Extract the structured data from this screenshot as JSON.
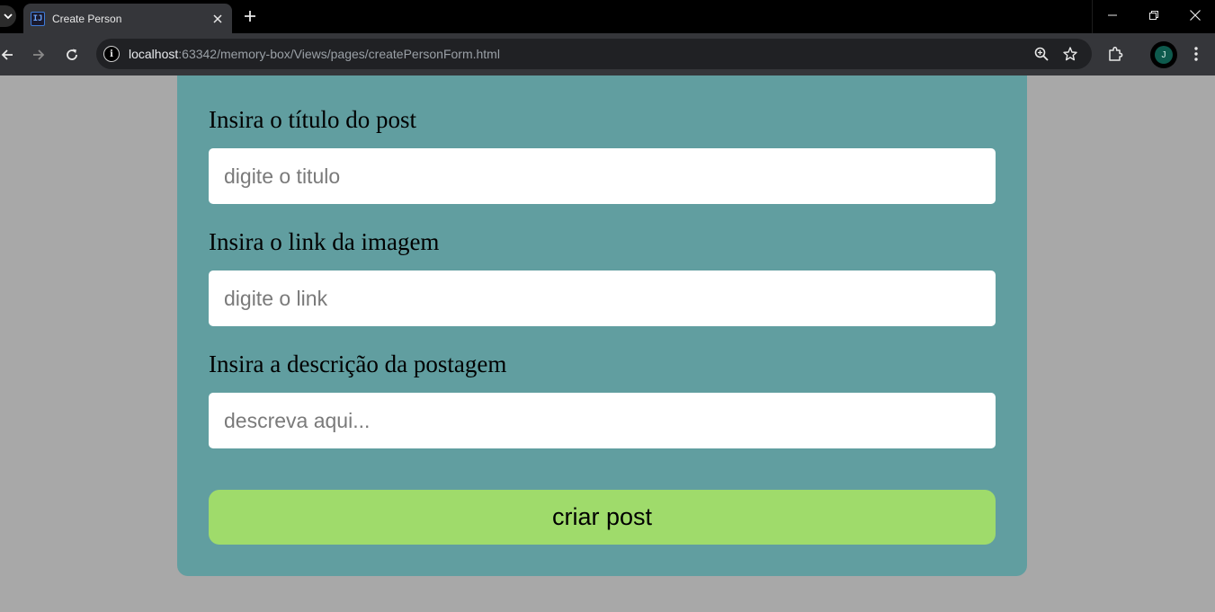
{
  "browser": {
    "tab_title": "Create Person",
    "favicon_text": "IJ",
    "url_host": "localhost",
    "url_path": ":63342/memory-box/Views/pages/createPersonForm.html",
    "profile_initial": "J"
  },
  "form": {
    "title_label": "Insira o título do post",
    "title_placeholder": "digite o titulo",
    "link_label": "Insira o link da imagem",
    "link_placeholder": "digite o link",
    "description_label": "Insira a descrição da postagem",
    "description_placeholder": "descreva aqui...",
    "submit_label": "criar post"
  },
  "colors": {
    "page_background": "#a8a8a8",
    "card_background": "#619ea0",
    "button_background": "#9fdb6b"
  }
}
